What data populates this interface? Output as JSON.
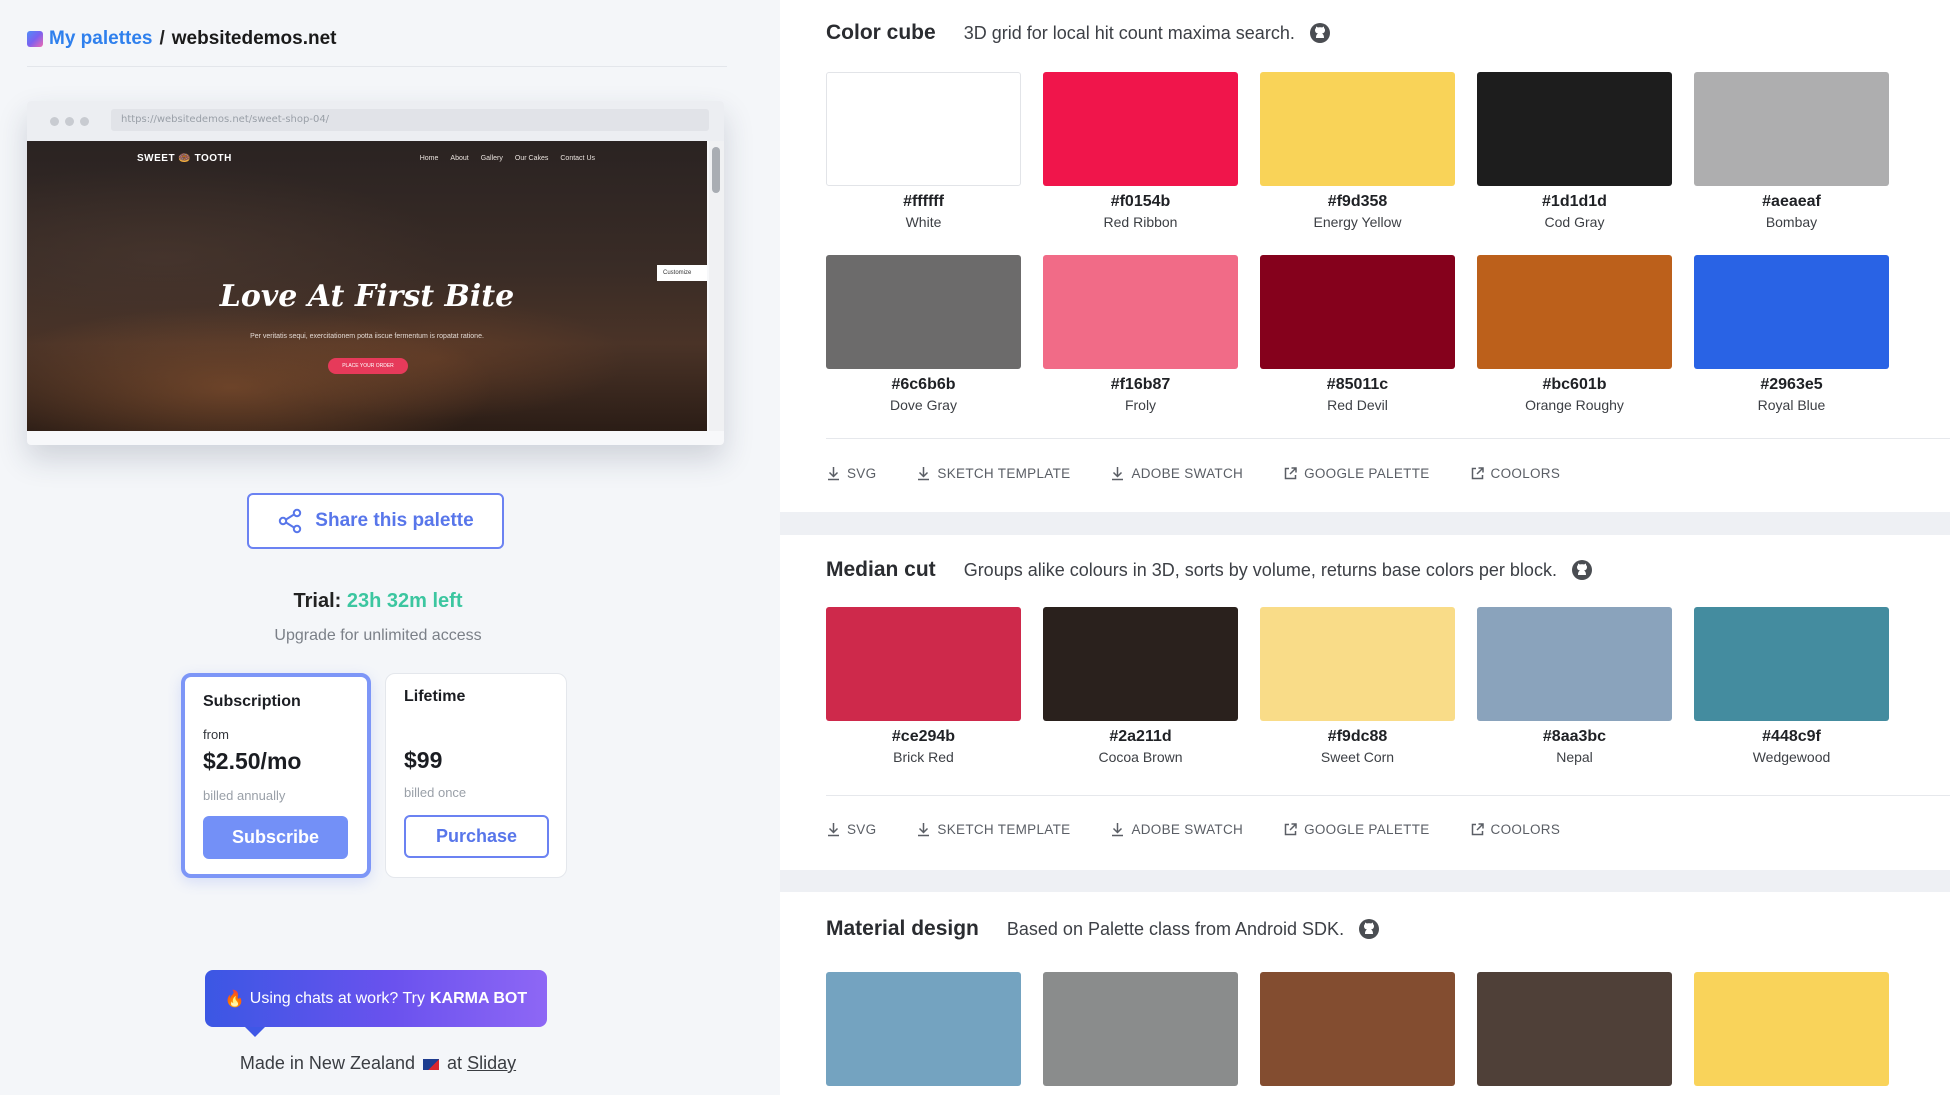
{
  "breadcrumb": {
    "root": "My palettes",
    "separator": "/",
    "site": "websitedemos.net"
  },
  "preview": {
    "url": "https://websitedemos.net/sweet-shop-04/",
    "brand": "SWEET 🍩 TOOTH",
    "nav": [
      "Home",
      "About",
      "Gallery",
      "Our Cakes",
      "Contact Us"
    ],
    "hero": "Love At First Bite",
    "subtitle": "Per veritatis sequi, exercitationem potta iiscue fermentum is ropatat ratione.",
    "cta": "PLACE YOUR ORDER",
    "customize": "Customize"
  },
  "share": {
    "label": "Share this palette"
  },
  "trial": {
    "label": "Trial:",
    "time_left": "23h 32m left",
    "upgrade": "Upgrade for unlimited access"
  },
  "plans": [
    {
      "name": "Subscription",
      "from": "from",
      "price": "$2.50/mo",
      "billed": "billed annually",
      "button": "Subscribe"
    },
    {
      "name": "Lifetime",
      "price": "$99",
      "billed": "billed once",
      "button": "Purchase"
    }
  ],
  "promo": {
    "text": "Using chats at work? Try",
    "brand": "KARMA BOT"
  },
  "footer": {
    "made": "Made in New Zealand",
    "at": "at",
    "company": "Sliday"
  },
  "sections": [
    {
      "title": "Color cube",
      "description": "3D grid for local hit count maxima search.",
      "colors": [
        {
          "hex": "#ffffff",
          "name": "White"
        },
        {
          "hex": "#f0154b",
          "name": "Red Ribbon"
        },
        {
          "hex": "#f9d358",
          "name": "Energy Yellow"
        },
        {
          "hex": "#1d1d1d",
          "name": "Cod Gray"
        },
        {
          "hex": "#aeaeaf",
          "name": "Bombay"
        },
        {
          "hex": "#6c6b6b",
          "name": "Dove Gray"
        },
        {
          "hex": "#f16b87",
          "name": "Froly"
        },
        {
          "hex": "#85011c",
          "name": "Red Devil"
        },
        {
          "hex": "#bc601b",
          "name": "Orange Roughy"
        },
        {
          "hex": "#2963e5",
          "name": "Royal Blue"
        }
      ]
    },
    {
      "title": "Median cut",
      "description": "Groups alike colours in 3D, sorts by volume, returns base colors per block.",
      "colors": [
        {
          "hex": "#ce294b",
          "name": "Brick Red"
        },
        {
          "hex": "#2a211d",
          "name": "Cocoa Brown"
        },
        {
          "hex": "#f9dc88",
          "name": "Sweet Corn"
        },
        {
          "hex": "#8aa3bc",
          "name": "Nepal"
        },
        {
          "hex": "#448c9f",
          "name": "Wedgewood"
        }
      ]
    },
    {
      "title": "Material design",
      "description": "Based on Palette class from Android SDK.",
      "colors": [
        {
          "swatch": "#74a3c0"
        },
        {
          "swatch": "#8a8c8c"
        },
        {
          "swatch": "#834d30"
        },
        {
          "swatch": "#4f4038"
        },
        {
          "swatch": "#f9d35a"
        }
      ]
    }
  ],
  "actions": [
    {
      "label": "SVG",
      "icon": "download-icon"
    },
    {
      "label": "SKETCH TEMPLATE",
      "icon": "download-icon"
    },
    {
      "label": "ADOBE SWATCH",
      "icon": "download-icon"
    },
    {
      "label": "GOOGLE PALETTE",
      "icon": "external-link-icon"
    },
    {
      "label": "COOLORS",
      "icon": "external-link-icon"
    }
  ],
  "theme": {
    "accent": "#5876ea",
    "trial_green": "#3cc6a0"
  }
}
